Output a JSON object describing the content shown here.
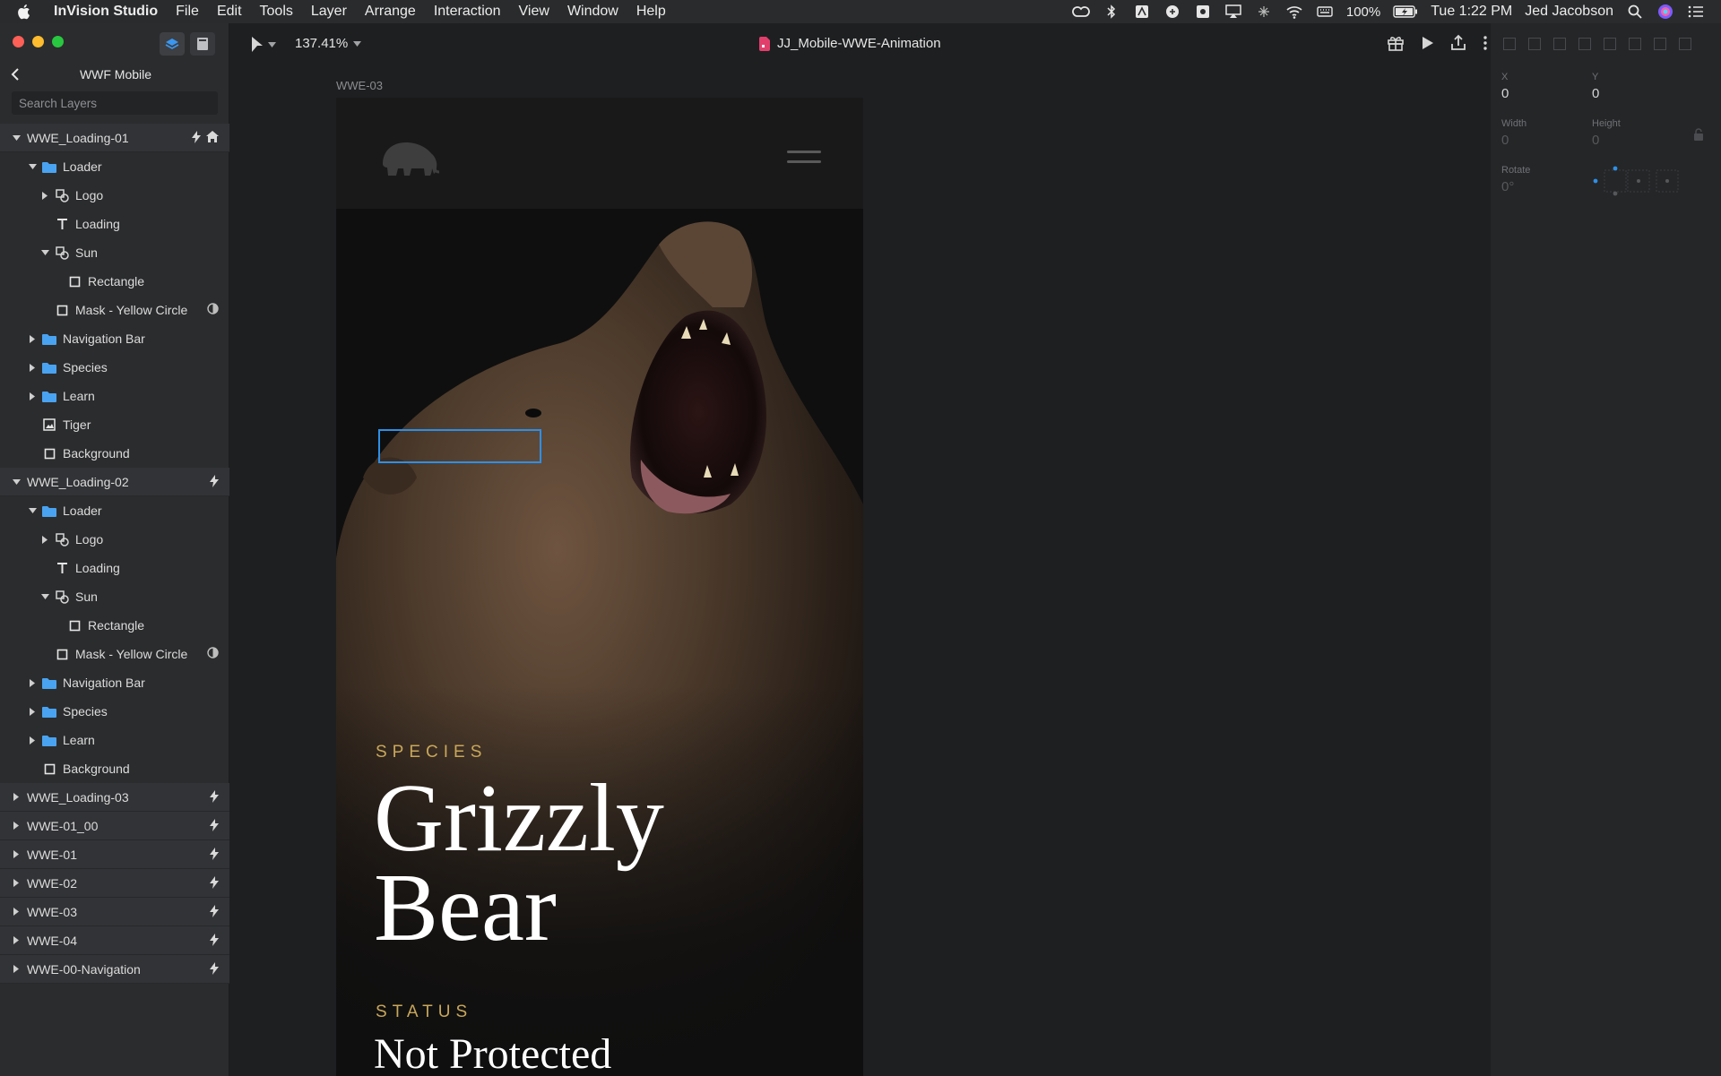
{
  "menubar": {
    "items": [
      "InVision Studio",
      "File",
      "Edit",
      "Tools",
      "Layer",
      "Arrange",
      "Interaction",
      "View",
      "Window",
      "Help"
    ],
    "battery": "100%",
    "clock": "Tue 1:22 PM",
    "user": "Jed Jacobson"
  },
  "panel": {
    "project_title": "WWF Mobile",
    "search_placeholder": "Search Layers"
  },
  "layers": [
    {
      "label": "WWE_Loading-01",
      "indent": 0,
      "caret": "down",
      "icon": "none",
      "top": true,
      "badges": [
        "bolt",
        "home"
      ]
    },
    {
      "label": "Loader",
      "indent": 1,
      "caret": "down",
      "icon": "folder",
      "top": false,
      "badges": []
    },
    {
      "label": "Logo",
      "indent": 2,
      "caret": "right",
      "icon": "symbol",
      "top": false,
      "badges": []
    },
    {
      "label": "Loading",
      "indent": 2,
      "caret": "none",
      "icon": "text",
      "top": false,
      "badges": []
    },
    {
      "label": "Sun",
      "indent": 2,
      "caret": "down",
      "icon": "symbol",
      "top": false,
      "badges": []
    },
    {
      "label": "Rectangle",
      "indent": 3,
      "caret": "none",
      "icon": "rect",
      "top": false,
      "badges": []
    },
    {
      "label": "Mask - Yellow Circle",
      "indent": 2,
      "caret": "none",
      "icon": "rect",
      "top": false,
      "badges": [
        "mask"
      ]
    },
    {
      "label": "Navigation Bar",
      "indent": 1,
      "caret": "right",
      "icon": "folder",
      "top": false,
      "badges": []
    },
    {
      "label": "Species",
      "indent": 1,
      "caret": "right",
      "icon": "folder",
      "top": false,
      "badges": []
    },
    {
      "label": "Learn",
      "indent": 1,
      "caret": "right",
      "icon": "folder",
      "top": false,
      "badges": []
    },
    {
      "label": "Tiger",
      "indent": 1,
      "caret": "none",
      "icon": "image",
      "top": false,
      "badges": []
    },
    {
      "label": "Background",
      "indent": 1,
      "caret": "none",
      "icon": "rect",
      "top": false,
      "badges": []
    },
    {
      "label": "WWE_Loading-02",
      "indent": 0,
      "caret": "down",
      "icon": "none",
      "top": true,
      "badges": [
        "bolt"
      ]
    },
    {
      "label": "Loader",
      "indent": 1,
      "caret": "down",
      "icon": "folder",
      "top": false,
      "badges": []
    },
    {
      "label": "Logo",
      "indent": 2,
      "caret": "right",
      "icon": "symbol",
      "top": false,
      "badges": []
    },
    {
      "label": "Loading",
      "indent": 2,
      "caret": "none",
      "icon": "text",
      "top": false,
      "badges": []
    },
    {
      "label": "Sun",
      "indent": 2,
      "caret": "down",
      "icon": "symbol",
      "top": false,
      "badges": []
    },
    {
      "label": "Rectangle",
      "indent": 3,
      "caret": "none",
      "icon": "rect",
      "top": false,
      "badges": []
    },
    {
      "label": "Mask - Yellow Circle",
      "indent": 2,
      "caret": "none",
      "icon": "rect",
      "top": false,
      "badges": [
        "mask"
      ]
    },
    {
      "label": "Navigation Bar",
      "indent": 1,
      "caret": "right",
      "icon": "folder",
      "top": false,
      "badges": []
    },
    {
      "label": "Species",
      "indent": 1,
      "caret": "right",
      "icon": "folder",
      "top": false,
      "badges": []
    },
    {
      "label": "Learn",
      "indent": 1,
      "caret": "right",
      "icon": "folder",
      "top": false,
      "badges": []
    },
    {
      "label": "Background",
      "indent": 1,
      "caret": "none",
      "icon": "rect",
      "top": false,
      "badges": []
    },
    {
      "label": "WWE_Loading-03",
      "indent": 0,
      "caret": "right",
      "icon": "none",
      "top": true,
      "badges": [
        "bolt"
      ]
    },
    {
      "label": "WWE-01_00",
      "indent": 0,
      "caret": "right",
      "icon": "none",
      "top": true,
      "badges": [
        "bolt"
      ]
    },
    {
      "label": "WWE-01",
      "indent": 0,
      "caret": "right",
      "icon": "none",
      "top": true,
      "badges": [
        "bolt"
      ]
    },
    {
      "label": "WWE-02",
      "indent": 0,
      "caret": "right",
      "icon": "none",
      "top": true,
      "badges": [
        "bolt"
      ]
    },
    {
      "label": "WWE-03",
      "indent": 0,
      "caret": "right",
      "icon": "none",
      "top": true,
      "badges": [
        "bolt"
      ]
    },
    {
      "label": "WWE-04",
      "indent": 0,
      "caret": "right",
      "icon": "none",
      "top": true,
      "badges": [
        "bolt"
      ]
    },
    {
      "label": "WWE-00-Navigation",
      "indent": 0,
      "caret": "right",
      "icon": "none",
      "top": true,
      "badges": [
        "bolt"
      ]
    }
  ],
  "toolbar": {
    "zoom": "137.41%",
    "document_name": "JJ_Mobile-WWE-Animation"
  },
  "artboard": {
    "label": "WWE-03",
    "species_label": "SPECIES",
    "name_line1": "Grizzly",
    "name_line2": "Bear",
    "status_label": "STATUS",
    "status_value": "Not Protected"
  },
  "inspector": {
    "x_label": "X",
    "x_value": "0",
    "y_label": "Y",
    "y_value": "0",
    "width_label": "Width",
    "width_value": "0",
    "height_label": "Height",
    "height_value": "0",
    "rotate_label": "Rotate",
    "rotate_value": "0°"
  },
  "colors": {
    "accent_blue": "#2e8fe6",
    "gold": "#c9a75a",
    "folder_blue": "#4aa3f0"
  }
}
